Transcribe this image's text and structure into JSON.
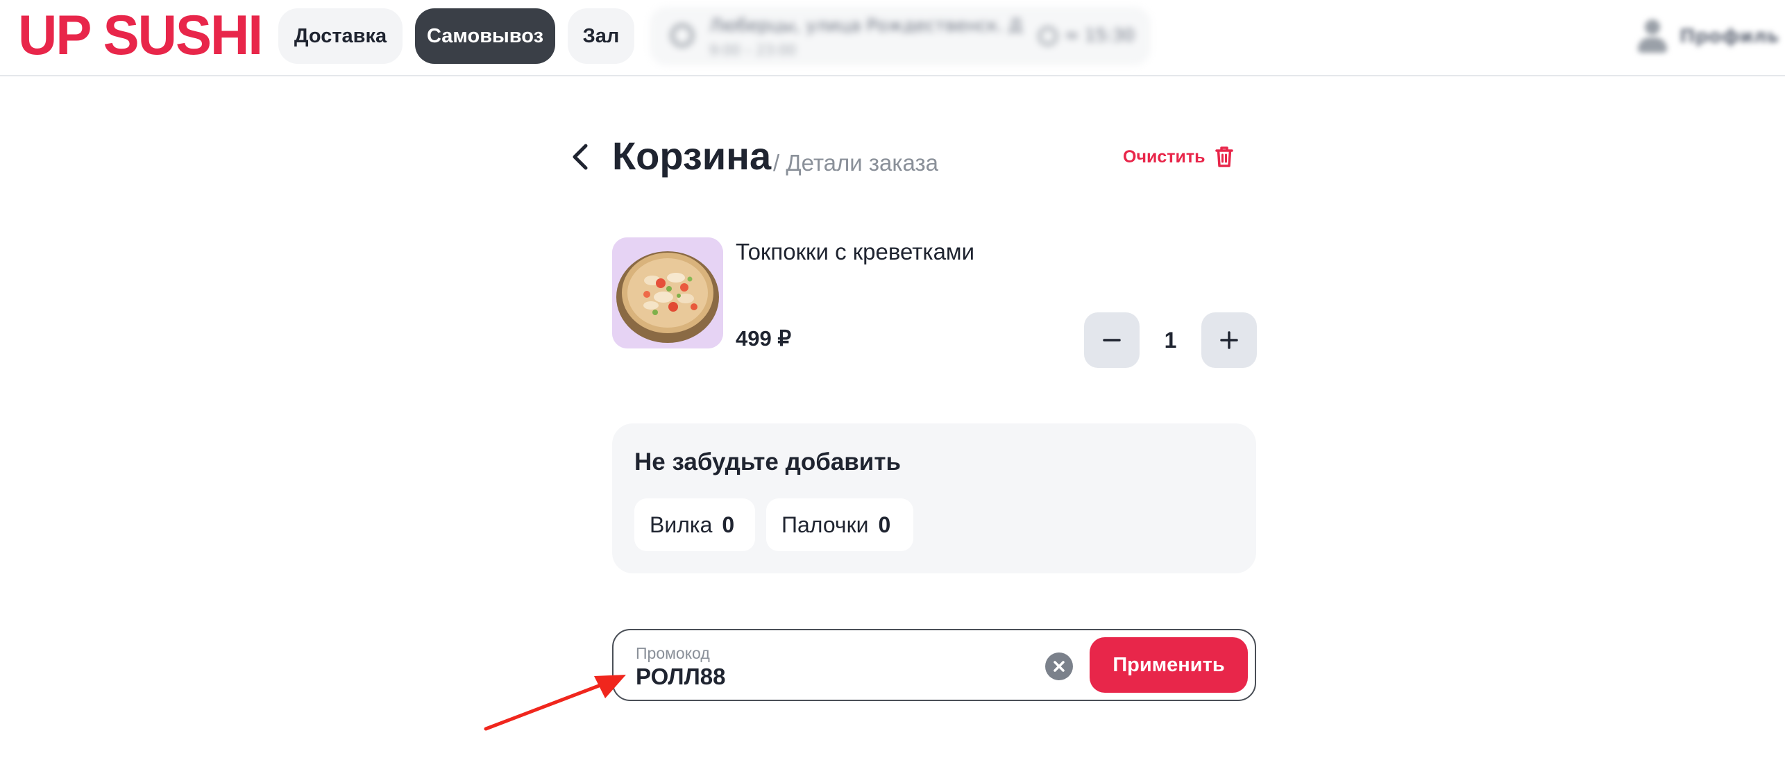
{
  "header": {
    "logo_text": "UP SUSHI",
    "brand_color": "#e8264a",
    "modes": [
      {
        "label": "Доставка",
        "active": false
      },
      {
        "label": "Самовывоз",
        "active": true
      },
      {
        "label": "Зал",
        "active": false
      }
    ],
    "address": {
      "street": "Люберцы, улица Рождественск. Д",
      "hours": "9:00 – 23:00",
      "eta": "≈ 15:30"
    },
    "profile_label": "Профиль"
  },
  "cart": {
    "title": "Корзина",
    "subtitle": "/ Детали заказа",
    "clear_label": "Очистить",
    "items": [
      {
        "name": "Токпокки с креветками",
        "price": "499 ₽",
        "quantity": "1"
      }
    ]
  },
  "addons": {
    "title": "Не забудьте добавить",
    "items": [
      {
        "label": "Вилка",
        "count": "0"
      },
      {
        "label": "Палочки",
        "count": "0"
      }
    ]
  },
  "promo": {
    "label": "Промокод",
    "value": "РОЛЛ88",
    "apply_label": "Применить"
  },
  "icons": {
    "back": "chevron-left-icon",
    "clear": "trash-icon",
    "minus": "minus-icon",
    "plus": "plus-icon",
    "promo_clear": "close-circle-icon",
    "annotation": "red-arrow-icon"
  }
}
